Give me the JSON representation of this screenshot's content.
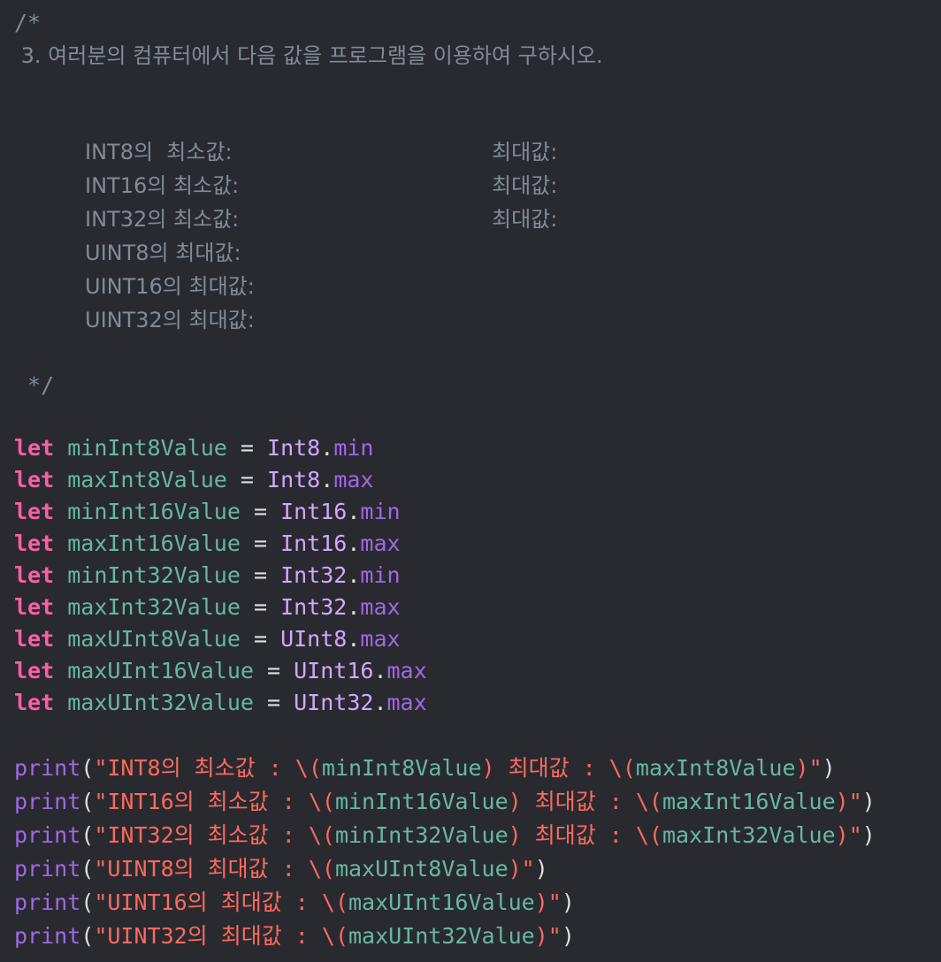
{
  "comment": {
    "open": "/*",
    "question": " 3. 여러분의 컴퓨터에서 다음 값을 프로그램을 이용하여 구하시오.",
    "rows": [
      {
        "left": "INT8의  최소값:",
        "right": "최대값:"
      },
      {
        "left": "INT16의 최소값:",
        "right": "최대값:"
      },
      {
        "left": "INT32의 최소값:",
        "right": "최대값:"
      },
      {
        "left": "UINT8의 최대값:",
        "right": ""
      },
      {
        "left": "UINT16의 최대값:",
        "right": ""
      },
      {
        "left": "UINT32의 최대값:",
        "right": ""
      }
    ],
    "close": " */"
  },
  "declarations": [
    {
      "kw": "let",
      "name": "minInt8Value",
      "eq": "=",
      "type": "Int8",
      "dot": ".",
      "prop": "min"
    },
    {
      "kw": "let",
      "name": "maxInt8Value",
      "eq": "=",
      "type": "Int8",
      "dot": ".",
      "prop": "max"
    },
    {
      "kw": "let",
      "name": "minInt16Value",
      "eq": "=",
      "type": "Int16",
      "dot": ".",
      "prop": "min"
    },
    {
      "kw": "let",
      "name": "maxInt16Value",
      "eq": "=",
      "type": "Int16",
      "dot": ".",
      "prop": "max"
    },
    {
      "kw": "let",
      "name": "minInt32Value",
      "eq": "=",
      "type": "Int32",
      "dot": ".",
      "prop": "min"
    },
    {
      "kw": "let",
      "name": "maxInt32Value",
      "eq": "=",
      "type": "Int32",
      "dot": ".",
      "prop": "max"
    },
    {
      "kw": "let",
      "name": "maxUInt8Value",
      "eq": "=",
      "type": "UInt8",
      "dot": ".",
      "prop": "max"
    },
    {
      "kw": "let",
      "name": "maxUInt16Value",
      "eq": "=",
      "type": "UInt16",
      "dot": ".",
      "prop": "max"
    },
    {
      "kw": "let",
      "name": "maxUInt32Value",
      "eq": "=",
      "type": "UInt32",
      "dot": ".",
      "prop": "max"
    }
  ],
  "prints": [
    {
      "fn": "print",
      "open": "(",
      "s1": "\"INT8의 최소값 : \\(",
      "v1": "minInt8Value",
      "s2": ") 최대값 : \\(",
      "v2": "maxInt8Value",
      "s3": ")\"",
      "close": ")"
    },
    {
      "fn": "print",
      "open": "(",
      "s1": "\"INT16의 최소값 : \\(",
      "v1": "minInt16Value",
      "s2": ") 최대값 : \\(",
      "v2": "maxInt16Value",
      "s3": ")\"",
      "close": ")"
    },
    {
      "fn": "print",
      "open": "(",
      "s1": "\"INT32의 최소값 : \\(",
      "v1": "minInt32Value",
      "s2": ") 최대값 : \\(",
      "v2": "maxInt32Value",
      "s3": ")\"",
      "close": ")"
    },
    {
      "fn": "print",
      "open": "(",
      "s1": "\"UINT8의 최대값 : \\(",
      "v1": "maxUInt8Value",
      "s2": ")\"",
      "v2": "",
      "s3": "",
      "close": ")"
    },
    {
      "fn": "print",
      "open": "(",
      "s1": "\"UINT16의 최대값 : \\(",
      "v1": "maxUInt16Value",
      "s2": ")\"",
      "v2": "",
      "s3": "",
      "close": ")"
    },
    {
      "fn": "print",
      "open": "(",
      "s1": "\"UINT32의 최대값 : \\(",
      "v1": "maxUInt32Value",
      "s2": ")\"",
      "v2": "",
      "s3": "",
      "close": ")"
    }
  ],
  "colors": {
    "background": "#292a30",
    "comment": "#7f8c98",
    "keyword": "#fc5fa3",
    "variable": "#67b7a4",
    "type": "#d0a8ff",
    "property": "#a167e6",
    "string": "#fc6a5d",
    "plain": "#dfdfe0"
  }
}
